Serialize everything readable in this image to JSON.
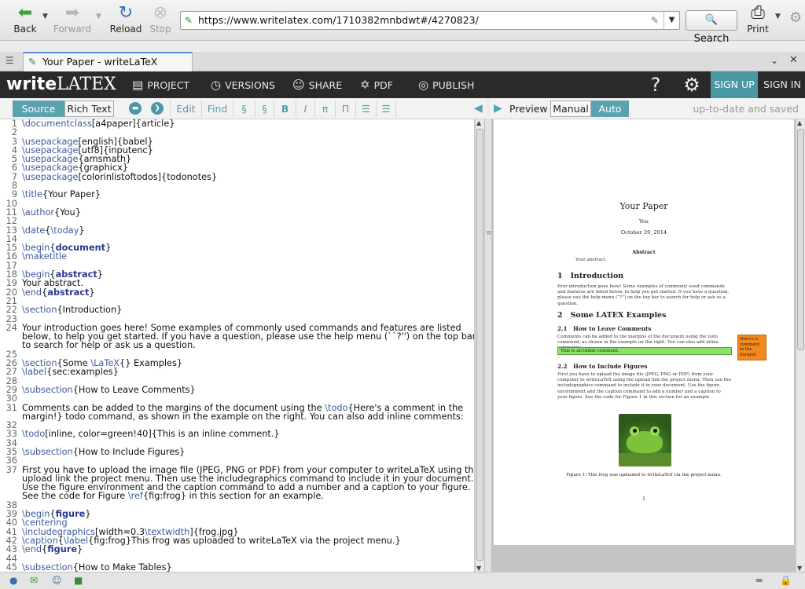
{
  "browser": {
    "back_label": "Back",
    "forward_label": "Forward",
    "reload_label": "Reload",
    "stop_label": "Stop",
    "url": "https://www.writelatex.com/1710382mnbdwt#/4270823/",
    "search_label": "Search",
    "print_label": "Print",
    "tab_title": "Your Paper - writeLaTeX"
  },
  "app": {
    "logo_write": "write",
    "logo_latex": "LATEX",
    "nav": [
      {
        "label": "PROJECT",
        "icon": "folder-icon"
      },
      {
        "label": "VERSIONS",
        "icon": "clock-icon"
      },
      {
        "label": "SHARE",
        "icon": "people-icon"
      },
      {
        "label": "PDF",
        "icon": "pdf-icon"
      },
      {
        "label": "PUBLISH",
        "icon": "globe-icon"
      }
    ],
    "help_symbol": "?",
    "signup_label": "SIGN UP",
    "signin_label": "SIGN IN",
    "accent_color": "#5aa2ae"
  },
  "editor_toolbar": {
    "source_label": "Source",
    "rich_label": "Rich Text",
    "edit_label": "Edit",
    "find_label": "Find",
    "section_symbol": "§",
    "subsection_symbol": "§",
    "bold_symbol": "B",
    "italic_symbol": "I",
    "pi_symbol": "π",
    "product_symbol": "Π"
  },
  "preview_toolbar": {
    "preview_label": "Preview",
    "manual_label": "Manual",
    "auto_label": "Auto",
    "status": "up-to-date and saved"
  },
  "code_lines": [
    {
      "n": "1",
      "segs": [
        [
          "cmd",
          "\\documentclass"
        ],
        [
          "",
          "[a4paper]{article}"
        ]
      ]
    },
    {
      "n": "2",
      "segs": []
    },
    {
      "n": "3",
      "segs": [
        [
          "cmd",
          "\\usepackage"
        ],
        [
          "",
          "[english]{babel}"
        ]
      ]
    },
    {
      "n": "4",
      "segs": [
        [
          "cmd",
          "\\usepackage"
        ],
        [
          "",
          "[utf8]{inputenc}"
        ]
      ]
    },
    {
      "n": "5",
      "segs": [
        [
          "cmd",
          "\\usepackage"
        ],
        [
          "",
          "{amsmath}"
        ]
      ]
    },
    {
      "n": "6",
      "segs": [
        [
          "cmd",
          "\\usepackage"
        ],
        [
          "",
          "{graphicx}"
        ]
      ]
    },
    {
      "n": "7",
      "segs": [
        [
          "cmd",
          "\\usepackage"
        ],
        [
          "",
          "[colorinlistoftodos]{todonotes}"
        ]
      ]
    },
    {
      "n": "8",
      "segs": []
    },
    {
      "n": "9",
      "segs": [
        [
          "cmd",
          "\\title"
        ],
        [
          "",
          "{Your Paper}"
        ]
      ]
    },
    {
      "n": "10",
      "segs": []
    },
    {
      "n": "11",
      "segs": [
        [
          "cmd",
          "\\author"
        ],
        [
          "",
          "{You}"
        ]
      ]
    },
    {
      "n": "12",
      "segs": []
    },
    {
      "n": "13",
      "segs": [
        [
          "cmd",
          "\\date"
        ],
        [
          "",
          "{"
        ],
        [
          "cmd",
          "\\today"
        ],
        [
          "",
          "}"
        ]
      ]
    },
    {
      "n": "14",
      "segs": []
    },
    {
      "n": "15",
      "segs": [
        [
          "cmd",
          "\\begin"
        ],
        [
          "",
          "{"
        ],
        [
          "env",
          "document"
        ],
        [
          "",
          "}"
        ]
      ]
    },
    {
      "n": "16",
      "segs": [
        [
          "cmd",
          "\\maketitle"
        ]
      ]
    },
    {
      "n": "17",
      "segs": []
    },
    {
      "n": "18",
      "segs": [
        [
          "cmd",
          "\\begin"
        ],
        [
          "",
          "{"
        ],
        [
          "env",
          "abstract"
        ],
        [
          "",
          "}"
        ]
      ]
    },
    {
      "n": "19",
      "segs": [
        [
          "",
          "Your abstract."
        ]
      ]
    },
    {
      "n": "20",
      "segs": [
        [
          "cmd",
          "\\end"
        ],
        [
          "",
          "{"
        ],
        [
          "env",
          "abstract"
        ],
        [
          "",
          "}"
        ]
      ]
    },
    {
      "n": "21",
      "segs": []
    },
    {
      "n": "22",
      "segs": [
        [
          "cmd",
          "\\section"
        ],
        [
          "",
          "{Introduction}"
        ]
      ]
    },
    {
      "n": "23",
      "segs": []
    },
    {
      "n": "24",
      "segs": [
        [
          "",
          "Your introduction goes here! Some examples of commonly used commands and features are listed"
        ]
      ]
    },
    {
      "n": "",
      "segs": [
        [
          "",
          "below, to help you get started. If you have a question, please use the help menu (``?'') on the top bar"
        ]
      ]
    },
    {
      "n": "",
      "segs": [
        [
          "",
          "to search for help or ask us a question."
        ]
      ]
    },
    {
      "n": "25",
      "segs": []
    },
    {
      "n": "26",
      "segs": [
        [
          "cmd",
          "\\section"
        ],
        [
          "",
          "{Some "
        ],
        [
          "cmd",
          "\\LaTeX"
        ],
        [
          "",
          "{} Examples}"
        ]
      ]
    },
    {
      "n": "27",
      "segs": [
        [
          "cmd",
          "\\label"
        ],
        [
          "",
          "{sec:examples}"
        ]
      ]
    },
    {
      "n": "28",
      "segs": []
    },
    {
      "n": "29",
      "segs": [
        [
          "cmd",
          "\\subsection"
        ],
        [
          "",
          "{How to Leave Comments}"
        ]
      ]
    },
    {
      "n": "30",
      "segs": []
    },
    {
      "n": "31",
      "segs": [
        [
          "",
          "Comments can be added to the margins of the document using the "
        ],
        [
          "cmd",
          "\\todo"
        ],
        [
          "",
          "{Here's a comment in the"
        ]
      ]
    },
    {
      "n": "",
      "segs": [
        [
          "",
          "margin!} todo command, as shown in the example on the right. You can also add inline comments:"
        ]
      ]
    },
    {
      "n": "32",
      "segs": []
    },
    {
      "n": "33",
      "segs": [
        [
          "cmd",
          "\\todo"
        ],
        [
          "",
          "[inline, color=green!40]{This is an inline comment.}"
        ]
      ]
    },
    {
      "n": "34",
      "segs": []
    },
    {
      "n": "35",
      "segs": [
        [
          "cmd",
          "\\subsection"
        ],
        [
          "",
          "{How to Include Figures}"
        ]
      ]
    },
    {
      "n": "36",
      "segs": []
    },
    {
      "n": "37",
      "segs": [
        [
          "",
          "First you have to upload the image file (JPEG, PNG or PDF) from your computer to writeLaTeX using the"
        ]
      ]
    },
    {
      "n": "",
      "segs": [
        [
          "",
          "upload link the project menu. Then use the includegraphics command to include it in your document."
        ]
      ]
    },
    {
      "n": "",
      "segs": [
        [
          "",
          "Use the figure environment and the caption command to add a number and a caption to your figure."
        ]
      ]
    },
    {
      "n": "",
      "segs": [
        [
          "",
          "See the code for Figure "
        ],
        [
          "cmd",
          "\\ref"
        ],
        [
          "",
          "{fig:frog} in this section for an example."
        ]
      ]
    },
    {
      "n": "38",
      "segs": []
    },
    {
      "n": "39",
      "segs": [
        [
          "cmd",
          "\\begin"
        ],
        [
          "",
          "{"
        ],
        [
          "env",
          "figure"
        ],
        [
          "",
          "}"
        ]
      ]
    },
    {
      "n": "40",
      "segs": [
        [
          "cmd",
          "\\centering"
        ]
      ]
    },
    {
      "n": "41",
      "segs": [
        [
          "cmd",
          "\\includegraphics"
        ],
        [
          "",
          "[width=0.3"
        ],
        [
          "cmd",
          "\\textwidth"
        ],
        [
          "",
          "]{frog.jpg}"
        ]
      ]
    },
    {
      "n": "42",
      "segs": [
        [
          "cmd",
          "\\caption"
        ],
        [
          "",
          "{"
        ],
        [
          "cmd",
          "\\label"
        ],
        [
          "",
          "{fig:frog}This frog was uploaded to writeLaTeX via the project menu.}"
        ]
      ]
    },
    {
      "n": "43",
      "segs": [
        [
          "cmd",
          "\\end"
        ],
        [
          "",
          "{"
        ],
        [
          "env",
          "figure"
        ],
        [
          "",
          "}"
        ]
      ]
    },
    {
      "n": "44",
      "segs": []
    },
    {
      "n": "45",
      "segs": [
        [
          "cmd",
          "\\subsection"
        ],
        [
          "",
          "{How to Make Tables}"
        ]
      ]
    }
  ],
  "pdf": {
    "title": "Your Paper",
    "author": "You",
    "date": "October 29, 2014",
    "abstract_heading": "Abstract",
    "abstract_text": "Your abstract.",
    "sec1_num": "1",
    "sec1_title": "Introduction",
    "sec1_text": "Your introduction goes here! Some examples of commonly used commands and features are listed below, to help you get started. If you have a question, please use the help menu (“?”) on the top bar to search for help or ask us a question.",
    "sec2_num": "2",
    "sec2_title": "Some LATEX Examples",
    "sub21_num": "2.1",
    "sub21_title": "How to Leave Comments",
    "sub21_text": "Comments can be added to the margins of the document using the todo command, as shown in the example on the right. You can also add inline comments:",
    "todo_margin": "Here's a comment in the margin!",
    "todo_inline": "This is an inline comment.",
    "sub22_num": "2.2",
    "sub22_title": "How to Include Figures",
    "sub22_text": "First you have to upload the image file (JPEG, PNG or PDF) from your computer to writeLaTeX using the upload link the project menu. Then use the includegraphics command to include it in your document. Use the figure environment and the caption command to add a number and a caption to your figure. See the code for Figure 1 in this section for an example.",
    "figure_caption": "Figure 1: This frog was uploaded to writeLaTeX via the project menu.",
    "page_number": "1"
  }
}
